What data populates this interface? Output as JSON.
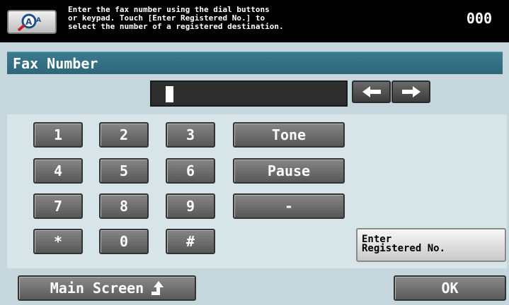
{
  "header": {
    "instruction": "Enter the fax number using the dial buttons\nor keypad. Touch [Enter Registered No.] to\nselect the number of a registered destination.",
    "job_count": "000",
    "zoom_icon": "magnifier-aa-icon"
  },
  "screen": {
    "title": "Fax Number",
    "fax_number_value": ""
  },
  "arrows": {
    "left_icon": "arrow-left-icon",
    "right_icon": "arrow-right-icon"
  },
  "keypad": {
    "keys": [
      "1",
      "2",
      "3",
      "4",
      "5",
      "6",
      "7",
      "8",
      "9",
      "*",
      "0",
      "#"
    ]
  },
  "functions": {
    "tone": "Tone",
    "pause": "Pause",
    "dash": "-"
  },
  "enter_registered": "Enter\nRegistered No.",
  "footer": {
    "main_screen": "Main Screen",
    "ok": "OK"
  },
  "colors": {
    "title_bar": "#2f6678",
    "panel_bg": "#c5d7dd",
    "key_bg": "#5a5a5a"
  }
}
